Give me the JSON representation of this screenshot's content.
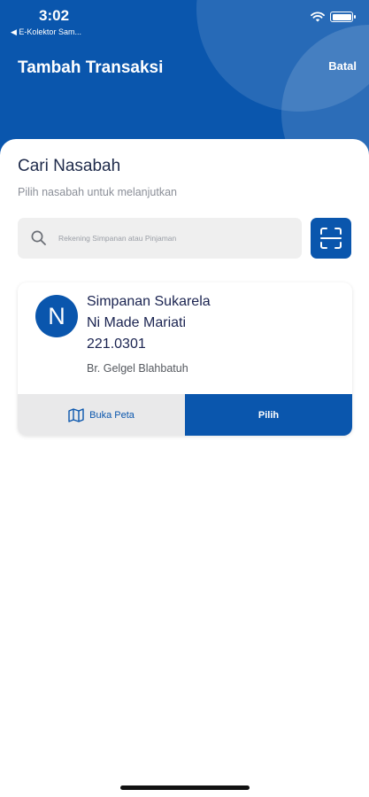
{
  "status_bar": {
    "time": "3:02",
    "back_app": "◀ E-Kolektor Sam..."
  },
  "header": {
    "title": "Tambah Transaksi",
    "cancel_label": "Batal"
  },
  "search_section": {
    "title": "Cari Nasabah",
    "subtitle": "Pilih nasabah untuk melanjutkan",
    "placeholder": "Rekening Simpanan atau Pinjaman",
    "value": ""
  },
  "result_card": {
    "avatar_letter": "N",
    "account_type": "Simpanan Sukarela",
    "name": "Ni Made Mariati",
    "account_number": "221.0301",
    "address": "Br. Gelgel Blahbatuh",
    "map_button_label": "Buka Peta",
    "select_button_label": "Pilih"
  },
  "icons": {
    "search": "search-icon",
    "scan": "scan-icon",
    "map": "map-icon",
    "wifi": "wifi-icon",
    "battery": "battery-icon"
  },
  "colors": {
    "primary": "#0a56ad",
    "surface_gray": "#efefef",
    "text_dark": "#1a2350"
  }
}
